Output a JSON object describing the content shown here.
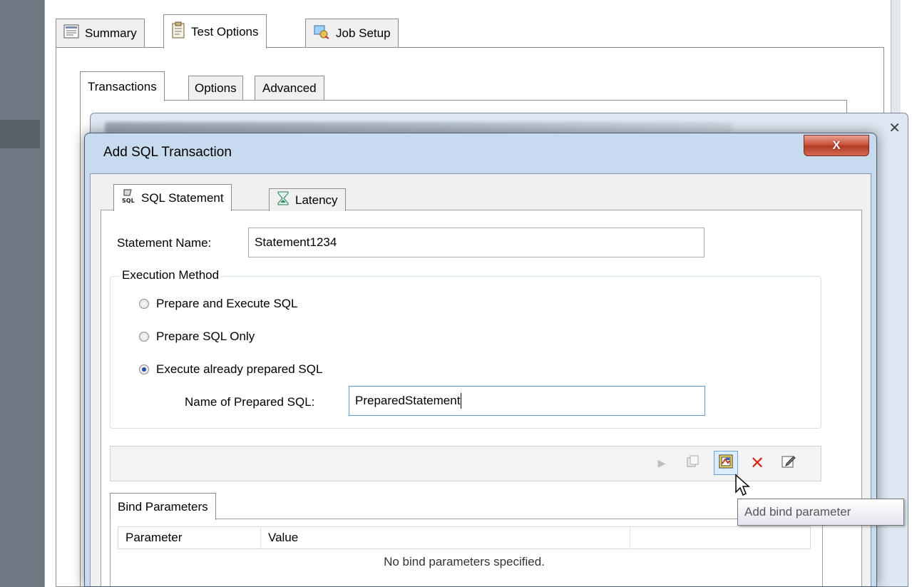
{
  "main_tabs": [
    {
      "label": "Summary",
      "icon": "summary-sheet-icon",
      "active": false
    },
    {
      "label": "Test Options",
      "icon": "clipboard-icon",
      "active": true
    },
    {
      "label": "Job Setup",
      "icon": "job-setup-icon",
      "active": false
    }
  ],
  "sub_tabs": [
    {
      "label": "Transactions",
      "active": true
    },
    {
      "label": "Options",
      "active": false
    },
    {
      "label": "Advanced",
      "active": false
    }
  ],
  "dialog": {
    "title": "Add  SQL Transaction",
    "close_glyph": "X",
    "tabs": [
      {
        "label": "SQL Statement",
        "icon": "sql-icon",
        "active": true
      },
      {
        "label": "Latency",
        "icon": "hourglass-icon",
        "active": false
      }
    ],
    "statement_name_label": "Statement Name:",
    "statement_name_value": "Statement1234",
    "execution_method": {
      "legend": "Execution Method",
      "options": [
        {
          "label": "Prepare and Execute SQL",
          "checked": false
        },
        {
          "label": "Prepare SQL Only",
          "checked": false
        },
        {
          "label": "Execute already prepared SQL",
          "checked": true
        }
      ],
      "prepared_name_label": "Name of Prepared SQL:",
      "prepared_name_value": "PreparedStatement"
    },
    "toolbar": {
      "buttons": [
        {
          "name": "play-icon",
          "glyph": "▶",
          "color": "#bdbdbd"
        },
        {
          "name": "copy-icon",
          "glyph": "❐",
          "color": "#a8a8a8"
        },
        {
          "name": "add-bind-parameter-icon",
          "glyph": "▣",
          "color": "#c0392b",
          "hover": true
        },
        {
          "name": "delete-icon",
          "glyph": "✕",
          "color": "#d12a1a"
        },
        {
          "name": "edit-icon",
          "glyph": "✎",
          "color": "#505050"
        }
      ],
      "tooltip": "Add bind parameter"
    },
    "bind_parameters": {
      "tab_label": "Bind Parameters",
      "columns": [
        "Parameter",
        "Value"
      ],
      "empty_message": "No bind parameters specified."
    }
  }
}
